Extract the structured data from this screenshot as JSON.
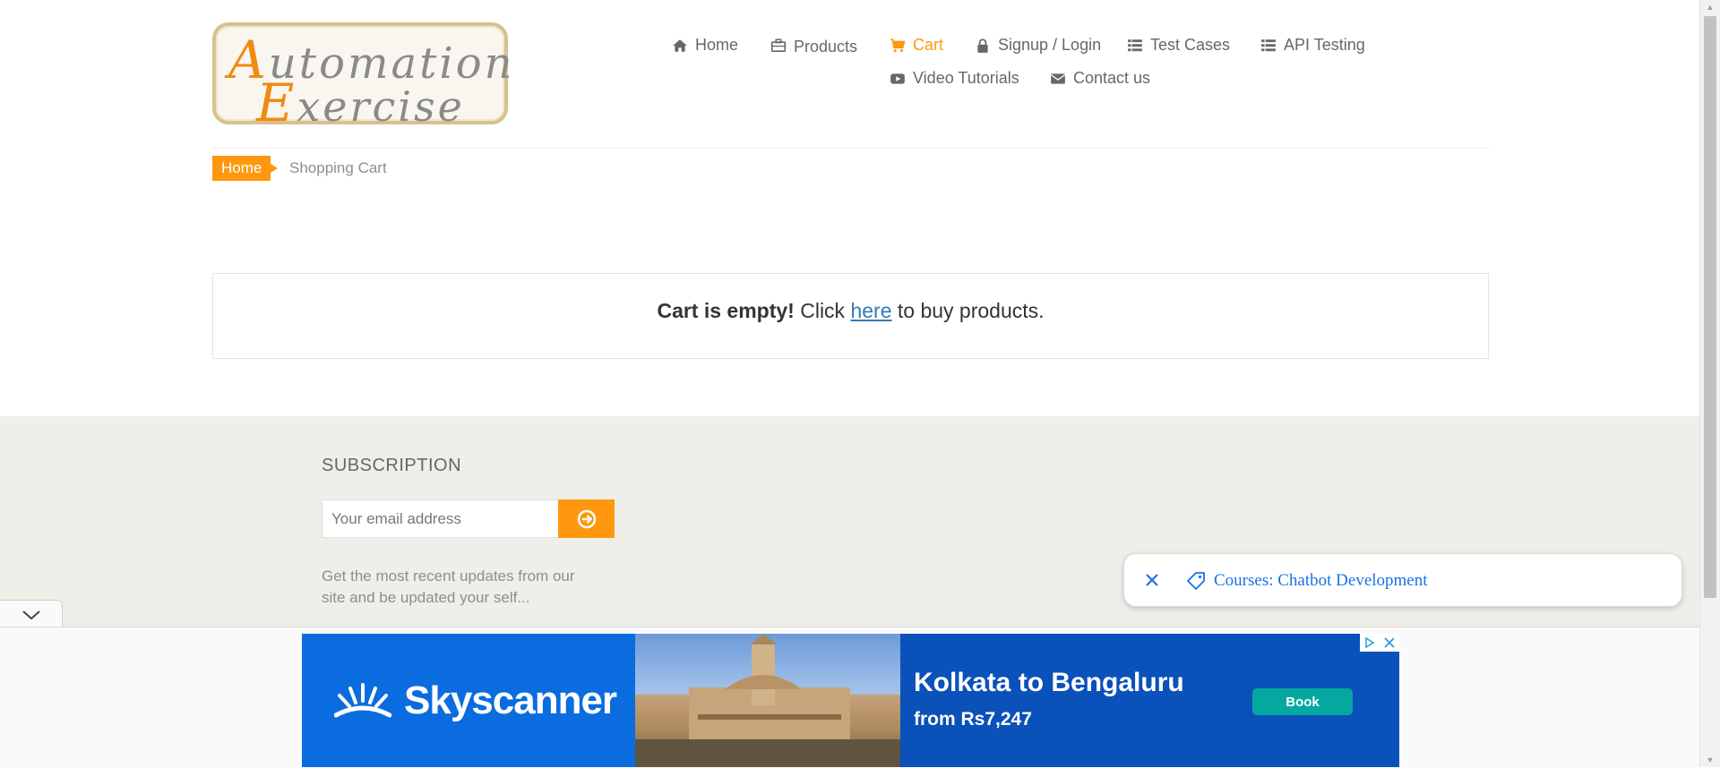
{
  "logo": {
    "line1_cap": "A",
    "line1_rest": "utomation",
    "line2_cap": "E",
    "line2_rest": "xercise"
  },
  "nav": {
    "home": "Home",
    "products": "Products",
    "cart": "Cart",
    "signup_login": "Signup / Login",
    "test_cases": "Test Cases",
    "api_testing": "API Testing",
    "video_tutorials": "Video Tutorials",
    "contact_us": "Contact us"
  },
  "breadcrumb": {
    "home": "Home",
    "current": "Shopping Cart"
  },
  "cart": {
    "empty_bold": "Cart is empty!",
    "click": "Click",
    "link": "here",
    "rest": "to buy products."
  },
  "subscription": {
    "title": "SUBSCRIPTION",
    "email_placeholder": "Your email address",
    "description": "Get the most recent updates from our site and be updated your self..."
  },
  "chatbot_pill": {
    "text": "Courses: Chatbot Development"
  },
  "ad": {
    "brand": "Skyscanner",
    "route": "Kolkata to Bengaluru",
    "price": "from Rs7,247",
    "cta": "Book"
  },
  "colors": {
    "accent": "#fe980f",
    "link": "#337ab7",
    "footer_bg": "#efeee8",
    "ad_blue": "#0a6cdf"
  }
}
